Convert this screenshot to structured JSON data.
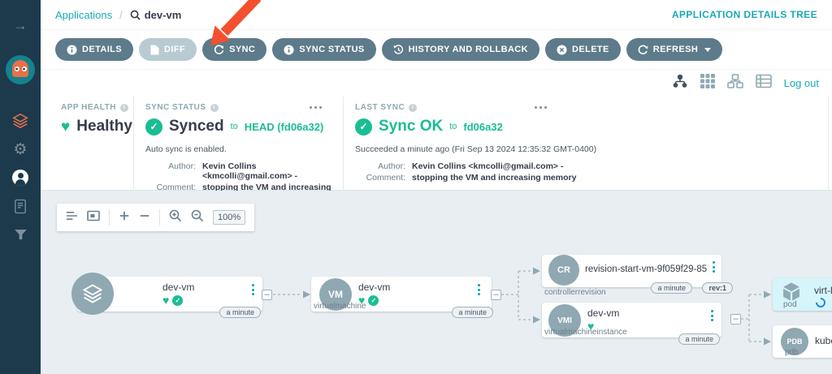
{
  "colors": {
    "teal": "#1ba8b8",
    "green": "#1bbd94",
    "slate_button": "#5d7b8a",
    "sidebar": "#1c3a4c",
    "graph_bg": "#e8eef2",
    "pod_highlight": "#d6f5fa",
    "annotation_arrow": "#f4502e"
  },
  "breadcrumb": {
    "root": "Applications",
    "separator": "/",
    "current": "dev-vm"
  },
  "topbar": {
    "view_title": "APPLICATION DETAILS TREE"
  },
  "toolbar": {
    "buttons": [
      {
        "label": "DETAILS"
      },
      {
        "label": "DIFF"
      },
      {
        "label": "SYNC"
      },
      {
        "label": "SYNC STATUS"
      },
      {
        "label": "HISTORY AND ROLLBACK"
      },
      {
        "label": "DELETE"
      },
      {
        "label": "REFRESH"
      }
    ]
  },
  "viewbar": {
    "logout_label": "Log out"
  },
  "panels": {
    "app_health": {
      "title": "APP HEALTH",
      "status": "Healthy"
    },
    "sync_status": {
      "title": "SYNC STATUS",
      "status": "Synced",
      "to_label": "to",
      "revision": "HEAD (fd06a32)",
      "note": "Auto sync is enabled.",
      "author_label": "Author:",
      "author": "Kevin Collins <kmcolli@gmail.com> -",
      "comment_label": "Comment:",
      "comment": "stopping the VM and increasing memory"
    },
    "last_sync": {
      "title": "LAST SYNC",
      "status": "Sync OK",
      "to_label": "to",
      "revision": "fd06a32",
      "note": "Succeeded a minute ago (Fri Sep 13 2024 12:35:32 GMT-0400)",
      "author_label": "Author:",
      "author": "Kevin Collins <kmcolli@gmail.com> -",
      "comment_label": "Comment:",
      "comment": "stopping the VM and increasing memory"
    }
  },
  "graph": {
    "zoom_level": "100%",
    "nodes": [
      {
        "name": "dev-vm",
        "kind": "application",
        "age": "a minute"
      },
      {
        "name": "dev-vm",
        "kind": "virtualmachine",
        "circle": "VM",
        "age": "a minute"
      },
      {
        "name": "revision-start-vm-9f059f29-85...",
        "kind": "controllerrevision",
        "circle": "CR",
        "age": "a minute",
        "rev": "rev:1"
      },
      {
        "name": "dev-vm",
        "kind": "virtualmachineinstance",
        "circle": "VMI",
        "age": "a minute"
      },
      {
        "name": "virt-l",
        "kind": "pod"
      },
      {
        "name": "kube",
        "kind": "pdb",
        "circle": "PDB"
      }
    ]
  }
}
